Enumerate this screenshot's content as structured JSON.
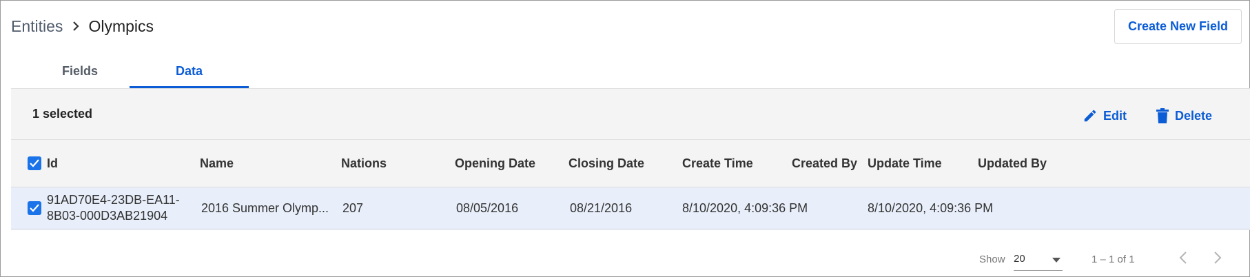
{
  "breadcrumb": {
    "root": "Entities",
    "current": "Olympics"
  },
  "header": {
    "create_button_label": "Create New Field"
  },
  "tabs": [
    {
      "label": "Fields",
      "active": false
    },
    {
      "label": "Data",
      "active": true
    }
  ],
  "commandbar": {
    "selected_text": "1 selected",
    "edit_label": "Edit",
    "delete_label": "Delete"
  },
  "table": {
    "columns": [
      "Id",
      "Name",
      "Nations",
      "Opening Date",
      "Closing Date",
      "Create Time",
      "Created By",
      "Update Time",
      "Updated By"
    ],
    "rows": [
      {
        "selected": true,
        "id": "91AD70E4-23DB-EA11-8B03-000D3AB21904",
        "name": "2016 Summer Olymp...",
        "nations": "207",
        "opening_date": "08/05/2016",
        "closing_date": "08/21/2016",
        "create_time": "8/10/2020, 4:09:36 PM",
        "created_by": "",
        "update_time": "8/10/2020, 4:09:36 PM",
        "updated_by": ""
      }
    ]
  },
  "pagination": {
    "show_label": "Show",
    "page_size": "20",
    "range_text": "1 – 1 of 1"
  },
  "colors": {
    "accent": "#0b5cd5",
    "checkbox": "#1a73e8",
    "selected_row": "#e8effa",
    "panel_bg": "#f4f4f4"
  },
  "icons": {
    "breadcrumb_separator": "chevron-right-icon",
    "edit": "pencil-icon",
    "delete": "trash-icon",
    "select_caret": "caret-down-icon",
    "prev": "chevron-left-icon",
    "next": "chevron-right-icon",
    "checkbox": "checkmark-icon"
  }
}
